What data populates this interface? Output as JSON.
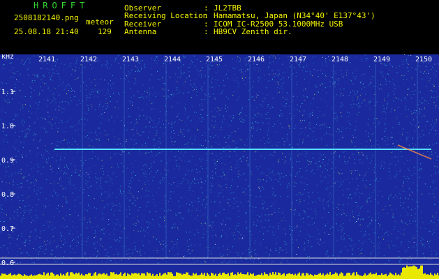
{
  "header": {
    "brand": "HROFFT",
    "filename": "2508182140.png",
    "datetime": "25.08.18 21:40",
    "meteor_label": "meteor",
    "meteor_count": "129",
    "fields": [
      {
        "label": "Observer",
        "value": "JL2TBB"
      },
      {
        "label": "Receiving Location",
        "value": "Hamamatsu, Japan (N34°40' E137°43')"
      },
      {
        "label": "Receiver",
        "value": "ICOM IC-R2500 53.1000MHz USB"
      },
      {
        "label": "Antenna",
        "value": "HB9CV Zenith dir."
      }
    ]
  },
  "axes": {
    "y_unit": "kHz",
    "y_ticks": [
      "1.1",
      "1.0",
      "0.9",
      "0.8",
      "0.7",
      "0.6"
    ],
    "x_ticks": [
      "2141",
      "2142",
      "2143",
      "2144",
      "2145",
      "2146",
      "2147",
      "2148",
      "2149",
      "2150"
    ]
  },
  "colors": {
    "background": "#1a2a9e",
    "noise_cyan": "#37c7d8",
    "noise_yellow": "#d9e84a",
    "signal": "#55e0ff",
    "header_text": "#f2f200",
    "brand": "#33d633"
  }
}
